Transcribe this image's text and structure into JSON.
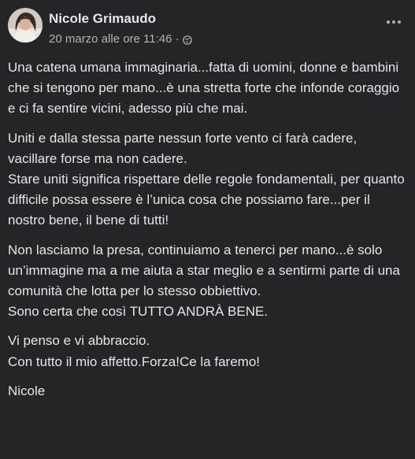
{
  "post": {
    "author": "Nicole Grimaudo",
    "timestamp": "20 marzo alle ore 11:46",
    "separator": "·",
    "audience_icon": "globe-icon",
    "more_icon": "more-options-icon",
    "paragraphs": [
      "Una catena umana immaginaria...fatta di uomini, donne e bambini che si tengono per mano...è una stretta forte che infonde coraggio e ci fa sentire vicini, adesso più che mai.",
      "Uniti e dalla stessa parte nessun forte vento ci farà cadere, vacillare forse ma non cadere.\nStare uniti significa rispettare delle regole fondamentali, per quanto difficile possa essere è l’unica cosa che possiamo fare...per il nostro bene, il bene di tutti!",
      "Non lasciamo la presa, continuiamo a tenerci per mano...è solo un’immagine ma a me aiuta a star meglio e a sentirmi parte di una comunità che lotta per lo stesso obbiettivo.\nSono certa che così TUTTO ANDRÀ BENE.",
      "Vi penso e vi abbraccio.\nCon tutto il mio affetto.Forza!Ce la faremo!",
      "Nicole"
    ]
  },
  "colors": {
    "background": "#242526",
    "primary_text": "#e4e6eb",
    "secondary_text": "#b0b3b8"
  }
}
